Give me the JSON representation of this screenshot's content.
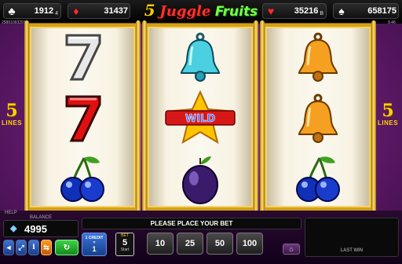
{
  "jackpots": [
    {
      "suit": "club-icon",
      "value": "1912",
      "sub": "4",
      "color": "#ffffff"
    },
    {
      "suit": "diamond-icon",
      "value": "31437",
      "sub": "",
      "color": "#ff2a2a"
    },
    {
      "suit": "heart-icon",
      "value": "35216",
      "sub": "B",
      "color": "#ff2a2a"
    },
    {
      "suit": "spade-icon",
      "value": "658175",
      "sub": "",
      "color": "#ffffff"
    }
  ],
  "logo": {
    "number": "5",
    "word1": "Juggle",
    "word2": "Fruits"
  },
  "ticker": {
    "left": "25861093291",
    "right": "9.46"
  },
  "lines": {
    "number": "5",
    "label": "LINES"
  },
  "reels": [
    [
      "seven-white",
      "seven-red",
      "cherries"
    ],
    [
      "bell-blue",
      "star-wild",
      "plum"
    ],
    [
      "bell-orange",
      "bell-orange",
      "cherries"
    ]
  ],
  "wild_text": "WILD",
  "help_label": "HELP",
  "balance": {
    "label": "BALANCE",
    "value": "4995"
  },
  "message": "PLEASE PLACE YOUR BET",
  "credit": {
    "top": "1 CREDIT",
    "eq": "=",
    "value": "1"
  },
  "bet": {
    "label": "BET",
    "value": "5",
    "start": "Start"
  },
  "bet_options": [
    "10",
    "25",
    "50",
    "100"
  ],
  "last_win_label": "LAST WIN",
  "colors": {
    "gold": "#d4a017",
    "panel": "#0a0a0a",
    "button_blue": "#2a5ab0"
  }
}
